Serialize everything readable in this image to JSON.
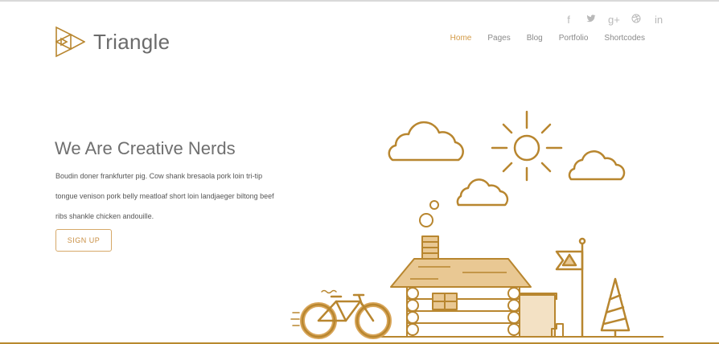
{
  "brand": {
    "name": "Triangle"
  },
  "social": [
    {
      "name": "facebook-icon",
      "glyph": "f"
    },
    {
      "name": "twitter-icon",
      "glyph": "🐦"
    },
    {
      "name": "google-plus-icon",
      "glyph": "g+"
    },
    {
      "name": "dribbble-icon",
      "glyph": "⊕"
    },
    {
      "name": "linkedin-icon",
      "glyph": "in"
    }
  ],
  "nav": [
    "Home",
    "Pages",
    "Blog",
    "Portfolio",
    "Shortcodes"
  ],
  "hero": {
    "title": "We Are Creative Nerds",
    "text_line1": "Boudin doner frankfurter pig. Cow shank bresaola pork loin tri-tip",
    "text_line2": "tongue venison pork belly meatloaf short loin landjaeger biltong beef",
    "text_line3": "ribs shankle chicken andouille.",
    "cta": "SIGN UP"
  },
  "colors": {
    "accent": "#d39a46",
    "illustration": "#b8862f",
    "fill": "#e9c893"
  }
}
